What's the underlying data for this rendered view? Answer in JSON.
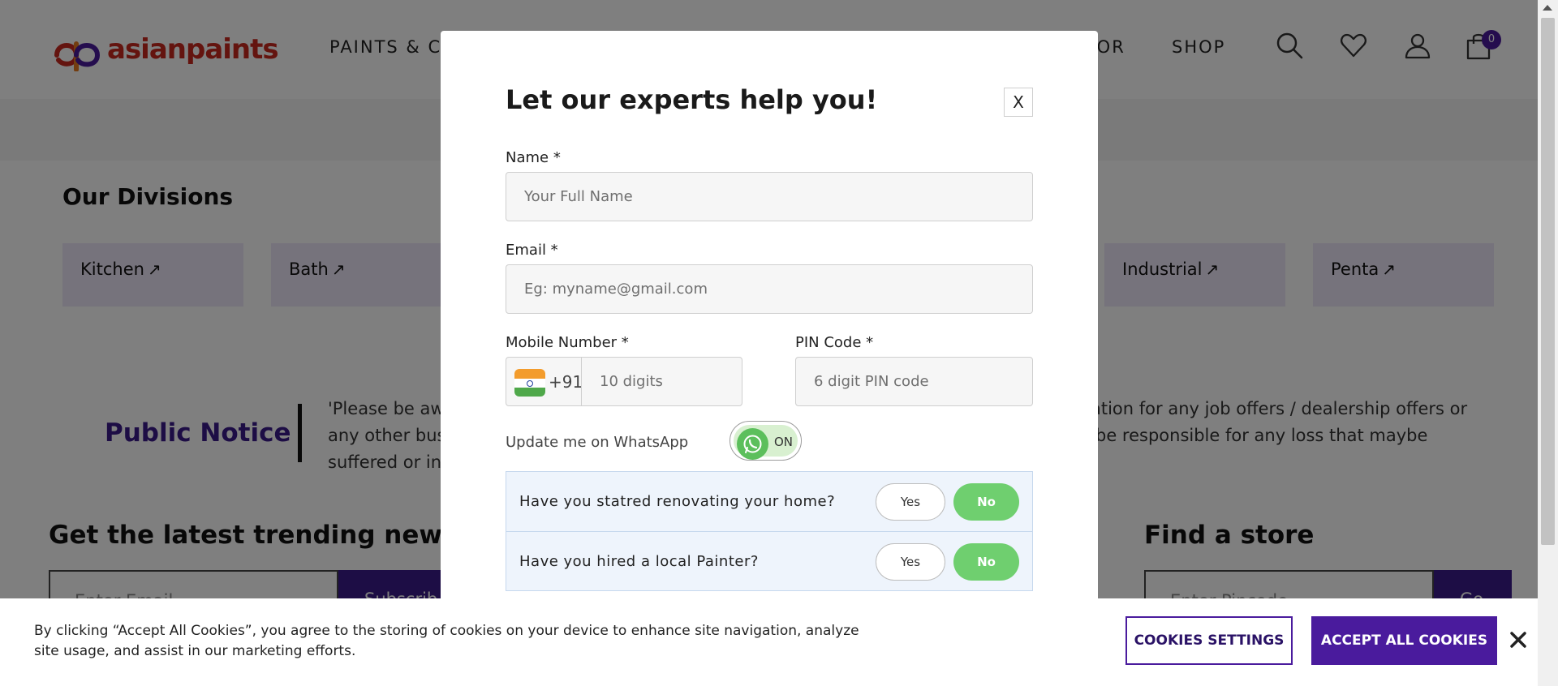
{
  "header": {
    "brand": "asianpaints",
    "nav": {
      "paints_partial": "PAINTS & C",
      "decor_partial": "COR",
      "shop": "SHOP"
    },
    "cart_count": "0",
    "icons": [
      "search-icon",
      "heart-icon",
      "user-icon",
      "cart-icon"
    ]
  },
  "divisions": {
    "title": "Our Divisions",
    "items": [
      "Kitchen",
      "Bath",
      "Industrial",
      "Penta"
    ],
    "arrow": "↗"
  },
  "notice": {
    "title": "Public Notice",
    "line1_left": "'Please be aw",
    "line1_right": "ation for any job offers / dealership offers or",
    "line2_left": "any other bus",
    "line2_right": "be responsible for any loss that maybe",
    "line3_left": "suffered or in"
  },
  "news": {
    "title": "Get the latest trending news",
    "input_partial": "Enter Email",
    "button_partial": "Subscrib"
  },
  "store": {
    "title": "Find a store",
    "input_partial": "Enter Pincode",
    "button_partial": "Go"
  },
  "modal": {
    "title": "Let our experts help you!",
    "close_label": "X",
    "name_label": "Name *",
    "name_placeholder": "Your Full Name",
    "email_label": "Email *",
    "email_placeholder": "Eg: myname@gmail.com",
    "mobile_label": "Mobile Number *",
    "country_code": "+91",
    "mobile_placeholder": "10 digits",
    "pin_label": "PIN Code *",
    "pin_placeholder": "6 digit PIN code",
    "whatsapp_label": "Update me on WhatsApp",
    "whatsapp_state": "ON",
    "questions": [
      {
        "text": "Have you statred renovating your home?",
        "yes": "Yes",
        "no": "No",
        "selected": "No"
      },
      {
        "text": "Have you hired a local Painter?",
        "yes": "Yes",
        "no": "No",
        "selected": "No"
      }
    ]
  },
  "cookie": {
    "text_line1": "By clicking “Accept All Cookies”, you agree to the storing of cookies on your device to enhance site navigation, analyze",
    "text_line2": "site usage, and assist in our marketing efforts.",
    "settings_label": "COOKIES SETTINGS",
    "accept_label": "ACCEPT ALL COOKIES"
  },
  "colors": {
    "brand_purple": "#4a1b9d",
    "brand_red": "#c8281e",
    "toggle_green": "#6fcf6f",
    "overlay": "rgba(0,0,0,0.5)"
  }
}
